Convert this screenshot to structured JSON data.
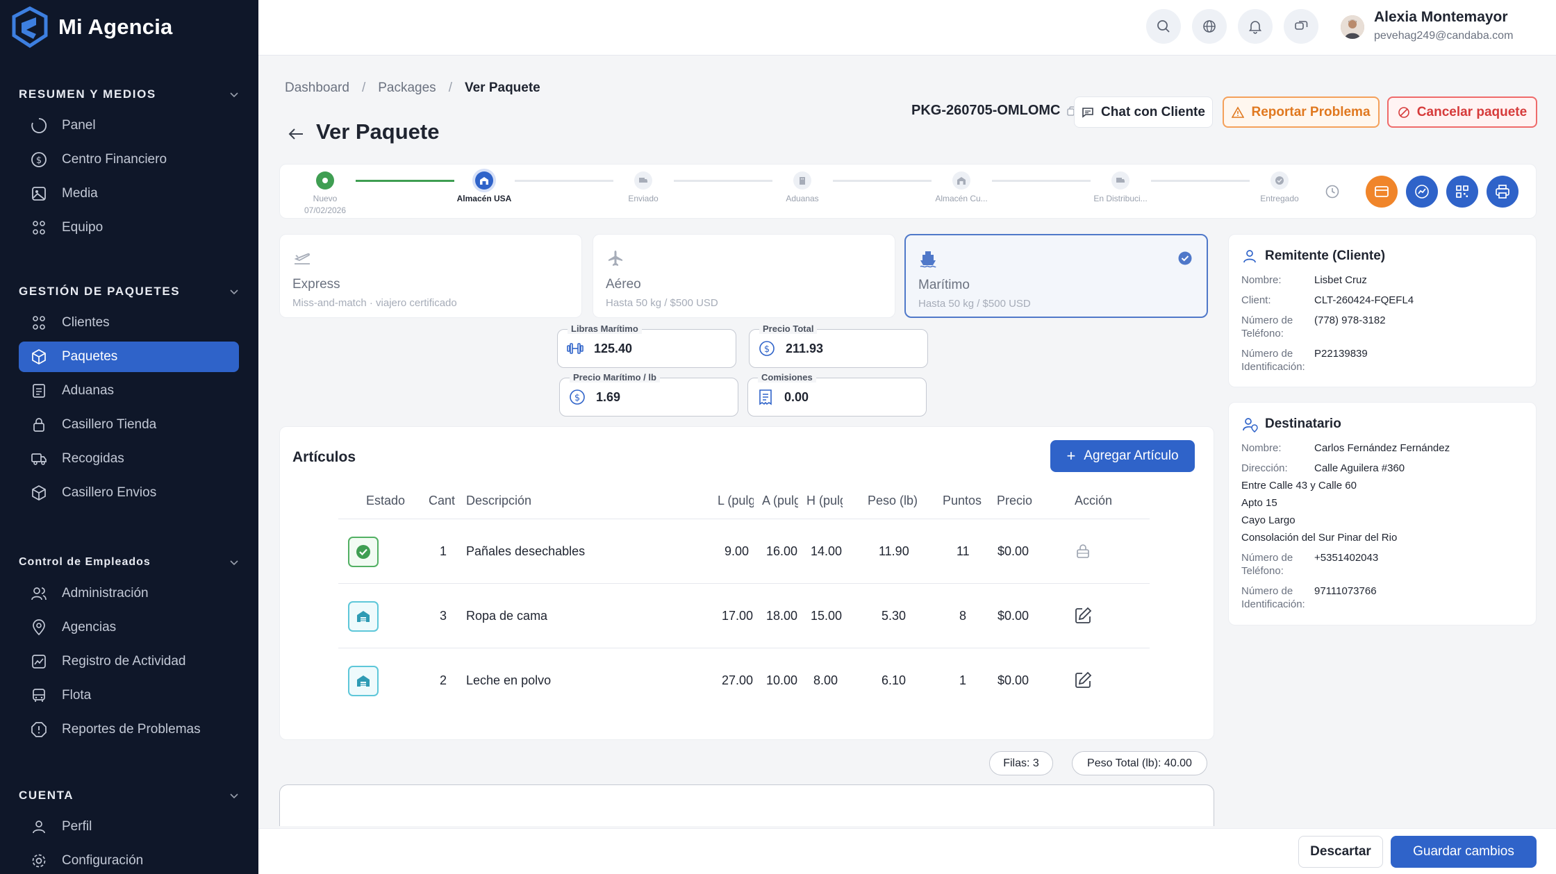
{
  "app": {
    "name": "Mi Agencia"
  },
  "sidebar": {
    "sections": [
      {
        "title": "RESUMEN Y MEDIOS",
        "items": [
          "Panel",
          "Centro Financiero",
          "Media",
          "Equipo"
        ]
      },
      {
        "title": "GESTIÓN DE PAQUETES",
        "items": [
          "Clientes",
          "Paquetes",
          "Aduanas",
          "Casillero Tienda",
          "Recogidas",
          "Casillero Envios"
        ]
      },
      {
        "title": "Control de Empleados",
        "items": [
          "Administración",
          "Agencias",
          "Registro de Actividad",
          "Flota",
          "Reportes de Problemas"
        ]
      },
      {
        "title": "CUENTA",
        "items": [
          "Perfil",
          "Configuración"
        ]
      }
    ],
    "active_item": "Paquetes"
  },
  "user": {
    "name": "Alexia Montemayor",
    "email": "pevehag249@candaba.com"
  },
  "breadcrumb": {
    "home": "Dashboard",
    "section": "Packages",
    "current": "Ver Paquete"
  },
  "page": {
    "title": "Ver Paquete",
    "package_code": "PKG-260705-OMLOMC",
    "chat_label": "Chat con Cliente",
    "report_label": "Reportar Problema",
    "cancel_label": "Cancelar paquete"
  },
  "stepper": {
    "steps": [
      {
        "label": "Nuevo",
        "date": "07/02/2026",
        "state": "done"
      },
      {
        "label": "Almacén USA",
        "date": "",
        "state": "current"
      },
      {
        "label": "Enviado",
        "date": "",
        "state": "pending"
      },
      {
        "label": "Aduanas",
        "date": "",
        "state": "pending"
      },
      {
        "label": "Almacén Cu...",
        "date": "",
        "state": "pending"
      },
      {
        "label": "En Distribuci...",
        "date": "",
        "state": "pending"
      },
      {
        "label": "Entregado",
        "date": "",
        "state": "pending"
      }
    ]
  },
  "services": [
    {
      "name": "Express",
      "desc": "Miss-and-match · viajero certificado",
      "selected": false
    },
    {
      "name": "Aéreo",
      "desc": "Hasta 50 kg / $500 USD",
      "selected": false
    },
    {
      "name": "Marítimo",
      "desc": "Hasta 50 kg / $500 USD",
      "selected": true
    }
  ],
  "fields": {
    "libras_label": "Libras Marítimo",
    "libras_value": "125.40",
    "precio_total_label": "Precio Total",
    "precio_total_value": "211.93",
    "precio_lb_label": "Precio Marítimo / lb",
    "precio_lb_value": "1.69",
    "comisiones_label": "Comisiones",
    "comisiones_value": "0.00"
  },
  "articles": {
    "title": "Artículos",
    "add_label": "Agregar Artículo",
    "columns": [
      "Estado",
      "Cant",
      "Descripción",
      "L (pulg",
      "A (pulg",
      "H (pulg",
      "Peso (lb)",
      "Puntos",
      "Precio",
      "Acción"
    ],
    "rows": [
      {
        "status": "ok",
        "qty": "1",
        "desc": "Pañales desechables",
        "l": "9.00",
        "a": "16.00",
        "h": "14.00",
        "peso": "11.90",
        "puntos": "11",
        "precio": "$0.00",
        "action": "lock"
      },
      {
        "status": "warehouse",
        "qty": "3",
        "desc": "Ropa de cama",
        "l": "17.00",
        "a": "18.00",
        "h": "15.00",
        "peso": "5.30",
        "puntos": "8",
        "precio": "$0.00",
        "action": "edit"
      },
      {
        "status": "warehouse",
        "qty": "2",
        "desc": "Leche en polvo",
        "l": "27.00",
        "a": "10.00",
        "h": "8.00",
        "peso": "6.10",
        "puntos": "1",
        "precio": "$0.00",
        "action": "edit"
      }
    ],
    "rows_count": "Filas: 3",
    "total_weight": "Peso Total (lb): 40.00"
  },
  "sender": {
    "title": "Remitente (Cliente)",
    "name_k": "Nombre:",
    "name": "Lisbet Cruz",
    "client_k": "Client:",
    "client": "CLT-260424-FQEFL4",
    "phone_k": "Número de Teléfono:",
    "phone": "(778) 978-3182",
    "id_k": "Número de Identificación:",
    "id": "P22139839"
  },
  "recipient": {
    "title": "Destinatario",
    "name_k": "Nombre:",
    "name": "Carlos Fernández Fernández",
    "addr_k": "Dirección:",
    "addr": "Calle Aguilera #360",
    "addr_lines": [
      "Entre Calle 43 y Calle 60",
      "Apto 15",
      "Cayo Largo",
      "Consolación del Sur Pinar del Rio"
    ],
    "phone_k": "Número de Teléfono:",
    "phone": "+5351402043",
    "id_k": "Número de Identificación:",
    "id": "97111073766"
  },
  "footer": {
    "discard": "Descartar",
    "save": "Guardar cambios"
  },
  "colors": {
    "primary": "#2f63c9",
    "sidebar": "#0f1729",
    "success": "#3f9e52",
    "warning": "#f4a05a",
    "danger": "#ef6a6a"
  }
}
